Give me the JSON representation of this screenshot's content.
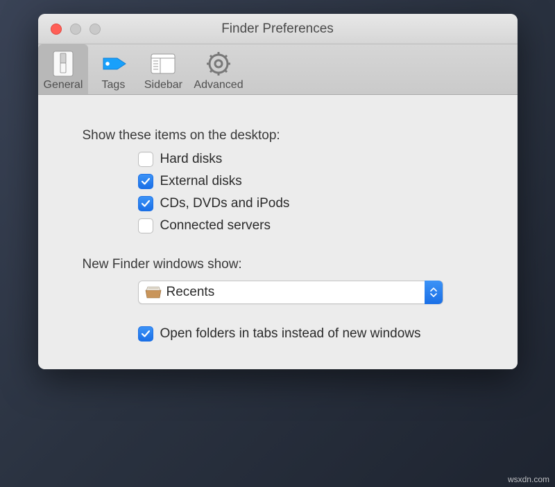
{
  "window": {
    "title": "Finder Preferences"
  },
  "toolbar": {
    "items": [
      {
        "label": "General",
        "active": true
      },
      {
        "label": "Tags",
        "active": false
      },
      {
        "label": "Sidebar",
        "active": false
      },
      {
        "label": "Advanced",
        "active": false
      }
    ]
  },
  "general": {
    "desktop_items_label": "Show these items on the desktop:",
    "items": [
      {
        "label": "Hard disks",
        "checked": false
      },
      {
        "label": "External disks",
        "checked": true
      },
      {
        "label": "CDs, DVDs and iPods",
        "checked": true
      },
      {
        "label": "Connected servers",
        "checked": false
      }
    ],
    "new_windows_label": "New Finder windows show:",
    "new_windows_value": "Recents",
    "open_in_tabs_label": "Open folders in tabs instead of new windows",
    "open_in_tabs_checked": true
  },
  "colors": {
    "accent": "#1a6fe6"
  },
  "watermark": "wsxdn.com"
}
